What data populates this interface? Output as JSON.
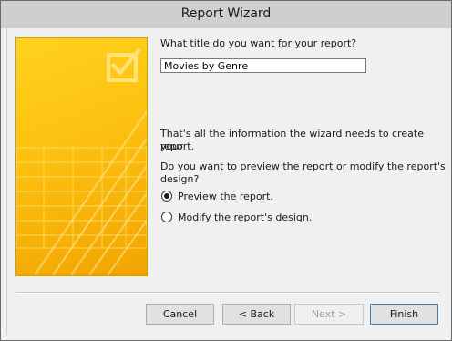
{
  "window": {
    "title": "Report Wizard"
  },
  "prompt": {
    "title_question": "What title do you want for your report?",
    "title_value": "Movies by Genre",
    "info_line1": "That's all the information the wizard needs to create your",
    "info_line2": "report.",
    "preview_question_line1": "Do you want to preview the report or modify the report's",
    "preview_question_line2": "design?"
  },
  "options": {
    "preview": {
      "label": "Preview the report.",
      "checked": true
    },
    "modify": {
      "label": "Modify the report's design.",
      "checked": false
    }
  },
  "buttons": {
    "cancel": "Cancel",
    "back": "< Back",
    "next": "Next >",
    "finish": "Finish"
  },
  "colors": {
    "banner_top": "#ffd21e",
    "banner_bottom": "#f2a400",
    "titlebar": "#cfcfcf"
  }
}
